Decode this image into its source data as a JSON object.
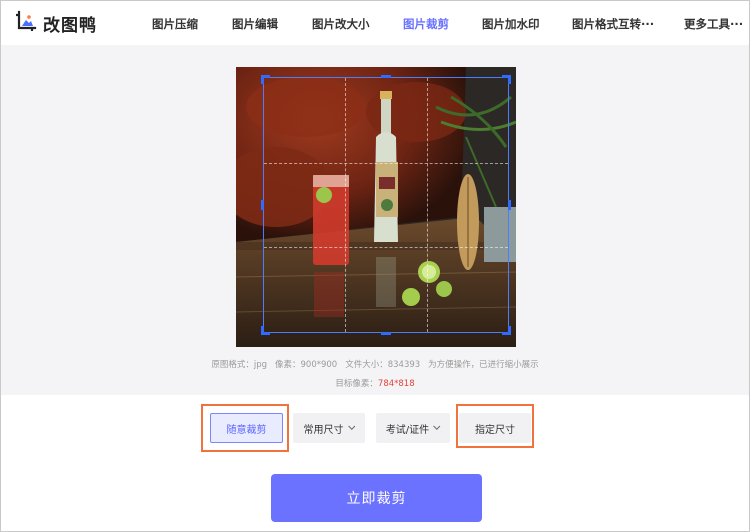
{
  "app": {
    "name": "改图鸭"
  },
  "nav": {
    "items": [
      {
        "label": "图片压缩"
      },
      {
        "label": "图片编辑"
      },
      {
        "label": "图片改大小"
      },
      {
        "label": "图片裁剪",
        "active": true
      },
      {
        "label": "图片加水印"
      },
      {
        "label": "图片格式互转···"
      },
      {
        "label": "更多工具···"
      }
    ]
  },
  "image_info": {
    "format_label": "原图格式：",
    "format_value": "jpg",
    "pixel_label": "像素：",
    "pixel_value": "900*900",
    "size_label": "文件大小：",
    "size_value": "834393",
    "note": "为方便操作，已进行缩小展示",
    "target_label": "目标像素：",
    "target_value": "784*818"
  },
  "crop_options": {
    "free": "随意裁剪",
    "common": "常用尺寸",
    "cert": "考试/证件",
    "custom": "指定尺寸"
  },
  "submit": {
    "label": "立即裁剪"
  },
  "colors": {
    "accent": "#6b72ff",
    "crop_border": "#2f6bff",
    "highlight": "#f0733d",
    "target_value": "#e0443a"
  }
}
